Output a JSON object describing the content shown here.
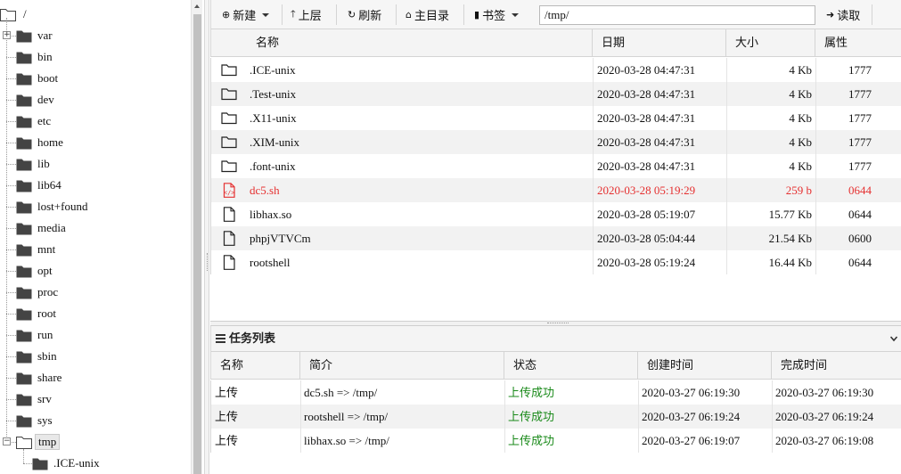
{
  "tree": {
    "root_label": "/",
    "items": [
      {
        "label": "var",
        "expander": "+"
      },
      {
        "label": "bin"
      },
      {
        "label": "boot"
      },
      {
        "label": "dev"
      },
      {
        "label": "etc"
      },
      {
        "label": "home"
      },
      {
        "label": "lib"
      },
      {
        "label": "lib64"
      },
      {
        "label": "lost+found"
      },
      {
        "label": "media"
      },
      {
        "label": "mnt"
      },
      {
        "label": "opt"
      },
      {
        "label": "proc"
      },
      {
        "label": "root"
      },
      {
        "label": "run"
      },
      {
        "label": "sbin"
      },
      {
        "label": "share"
      },
      {
        "label": "srv"
      },
      {
        "label": "sys"
      },
      {
        "label": "tmp",
        "expander": "−",
        "selected": true,
        "open": true
      }
    ],
    "children": [
      {
        "label": ".ICE-unix"
      }
    ]
  },
  "toolbar": {
    "new_label": "新建",
    "up_label": "上层",
    "refresh_label": "刷新",
    "home_label": "主目录",
    "bookmark_label": "书签",
    "path_value": "/tmp/",
    "read_label": "读取"
  },
  "files": {
    "columns": [
      "名称",
      "日期",
      "大小",
      "属性"
    ],
    "rows": [
      {
        "icon": "folder-icon",
        "name": ".ICE-unix",
        "date": "2020-03-28 04:47:31",
        "size": "4 Kb",
        "perm": "1777"
      },
      {
        "icon": "folder-icon",
        "name": ".Test-unix",
        "date": "2020-03-28 04:47:31",
        "size": "4 Kb",
        "perm": "1777"
      },
      {
        "icon": "folder-icon",
        "name": ".X11-unix",
        "date": "2020-03-28 04:47:31",
        "size": "4 Kb",
        "perm": "1777"
      },
      {
        "icon": "folder-icon",
        "name": ".XIM-unix",
        "date": "2020-03-28 04:47:31",
        "size": "4 Kb",
        "perm": "1777"
      },
      {
        "icon": "folder-icon",
        "name": ".font-unix",
        "date": "2020-03-28 04:47:31",
        "size": "4 Kb",
        "perm": "1777"
      },
      {
        "icon": "code-file-icon",
        "name": "dc5.sh",
        "date": "2020-03-28 05:19:29",
        "size": "259 b",
        "perm": "0644",
        "highlight": true
      },
      {
        "icon": "file-icon",
        "name": "libhax.so",
        "date": "2020-03-28 05:19:07",
        "size": "15.77 Kb",
        "perm": "0644"
      },
      {
        "icon": "file-icon",
        "name": "phpjVTVCm",
        "date": "2020-03-28 05:04:44",
        "size": "21.54 Kb",
        "perm": "0600"
      },
      {
        "icon": "file-icon",
        "name": "rootshell",
        "date": "2020-03-28 05:19:24",
        "size": "16.44 Kb",
        "perm": "0644"
      }
    ]
  },
  "tasks": {
    "title": "任务列表",
    "columns": [
      "名称",
      "简介",
      "状态",
      "创建时间",
      "完成时间"
    ],
    "rows": [
      {
        "name": "上传",
        "desc": "dc5.sh => /tmp/",
        "status": "上传成功",
        "created": "2020-03-27 06:19:30",
        "done": "2020-03-27 06:19:30"
      },
      {
        "name": "上传",
        "desc": "rootshell => /tmp/",
        "status": "上传成功",
        "created": "2020-03-27 06:19:24",
        "done": "2020-03-27 06:19:24"
      },
      {
        "name": "上传",
        "desc": "libhax.so => /tmp/",
        "status": "上传成功",
        "created": "2020-03-27 06:19:07",
        "done": "2020-03-27 06:19:08"
      }
    ]
  },
  "colors": {
    "highlight_text": "#e53030",
    "status_ok": "#1a8a1a"
  }
}
